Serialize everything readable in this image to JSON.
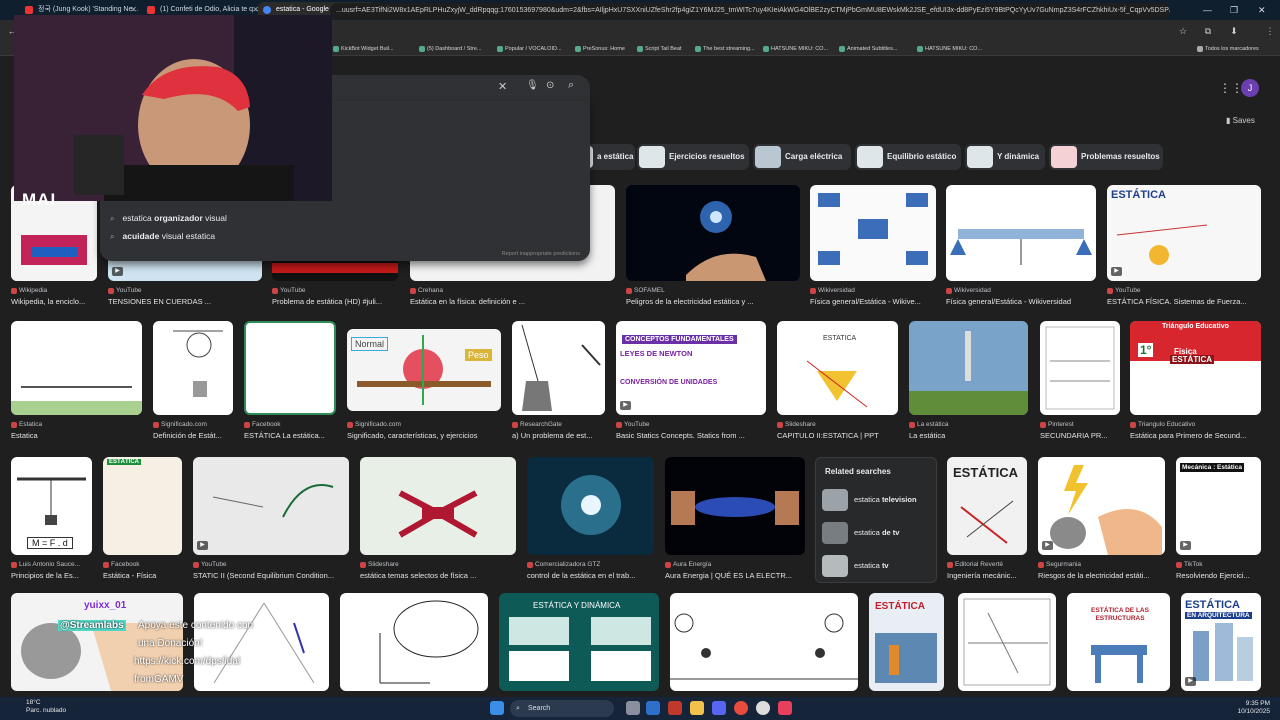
{
  "browser": {
    "tabs": [
      {
        "label": "정국 (Jung Kook) 'Standing Ne..."
      },
      {
        "label": "(1) Confeti de Odio, Alicia te q..."
      },
      {
        "label": "estatica - Google Search"
      }
    ],
    "new_tab": "+",
    "address": "...uusrf=AE3TifNi2W8x1AEpRLPHuZxyjW_ddRpqqg:1760153697980&udm=2&fbs=AIljpHxU7SXXniUZfeShr2fp4giZ1Y6MJ25_tmWITc7uy4KIeiAkWG4OlBE2zyCTMjPbGmMU8EWskMk2JSE_efdUI3x-dd8PyEzi5Y9BtPQcYyUv7GuNmpZ3S4rFCZhkhiUx-5f_CqpVv5DSP3Og5...",
    "bookmarks": [
      "KickBot Widget Buil...",
      "(5) Dashboard / Stre...",
      "Popular / VOCALOID...",
      "PreSonus: Home",
      "Script Tail Beat",
      "The best streaming...",
      "HATSUNE MIKU: CO...",
      "Animated Subtitles...",
      "HATSUNE MIKU: CO..."
    ],
    "all_bookmarks": "Todos los marcadores"
  },
  "header": {
    "account_initial": "J",
    "saves_label": "Saves"
  },
  "suggestions": {
    "items": [
      {
        "prefix": "estatica ",
        "bold": "organizador",
        "suffix": " visual"
      },
      {
        "prefix": "",
        "bold": "acuidade",
        "suffix": " visual estatica"
      }
    ],
    "report": "Report inappropriate predictions"
  },
  "chips": [
    "a estática",
    "Ejercicios resueltos",
    "Carga eléctrica",
    "Equilibrio estático",
    "Y dinámica",
    "Problemas resueltos"
  ],
  "row1": [
    {
      "src": "Wikipedia",
      "title": "Wikipedia, la enciclo..."
    },
    {
      "src": "YouTube",
      "title": "TENSIONES EN CUERDAS ..."
    },
    {
      "src": "YouTube",
      "title": "Problema de estática (HD) #juli..."
    },
    {
      "src": "Crehana",
      "title": "Estática en la física: definición e ..."
    },
    {
      "src": "SOFAMEL",
      "title": "Peligros de la electricidad estática y ..."
    },
    {
      "src": "Wikiversidad",
      "title": "Física general/Estática - Wikive..."
    },
    {
      "src": "Wikiversidad",
      "title": "Física general/Estática - Wikiversidad"
    },
    {
      "src": "YouTube",
      "title": "ESTÁTICA FÍSICA. Sistemas de Fuerza..."
    }
  ],
  "row2": [
    {
      "src": "Estatica",
      "title": "Estatica"
    },
    {
      "src": "Significado.com",
      "title": "Definición de Estát..."
    },
    {
      "src": "Facebook",
      "title": "ESTÁTICA La estática..."
    },
    {
      "src": "Significado.com",
      "title": "Significado, características, y ejercicios"
    },
    {
      "src": "ResearchGate",
      "title": "a) Un problema de est..."
    },
    {
      "src": "YouTube",
      "title": "Basic Statics Concepts. Statics from ..."
    },
    {
      "src": "Slideshare",
      "title": "CAPITULO II:ESTATICA | PPT"
    },
    {
      "src": "La estática",
      "title": "La estática"
    },
    {
      "src": "Pinterest",
      "title": "SECUNDARIA PR..."
    },
    {
      "src": "Triangulo Educativo",
      "title": "Estática para Primero de Secund..."
    }
  ],
  "row3": [
    {
      "src": "Luis Antonio Sauce...",
      "title": "Principios de la Es..."
    },
    {
      "src": "Facebook",
      "title": "Estática - Física"
    },
    {
      "src": "YouTube",
      "title": "STATIC II (Second Equilibrium Condition..."
    },
    {
      "src": "Slideshare",
      "title": "estática temas selectos de física ..."
    },
    {
      "src": "Comercializadora GTZ",
      "title": "control de la estática en el trab..."
    },
    {
      "src": "Aura Energía",
      "title": "Aura Energia | QUÉ ES LA ELECTR..."
    },
    {
      "src": "Editorial Reverté",
      "title": "Ingeniería mecánic..."
    },
    {
      "src": "Segurmania",
      "title": "Riesgos de la electricidad estáti..."
    },
    {
      "src": "TikTok",
      "title": "Resolviendo Ejercici..."
    }
  ],
  "related": {
    "heading": "Related searches",
    "items": [
      {
        "prefix": "estatica ",
        "bold": "television"
      },
      {
        "prefix": "estatica ",
        "bold": "de tv"
      },
      {
        "prefix": "estatica ",
        "bold": "tv"
      }
    ]
  },
  "image_text": {
    "row1_estatica": "ESTÁTICA",
    "row2_normal": "Normal",
    "row2_peso": "Peso",
    "row2_conceptos": "CONCEPTOS FUNDAMENTALES",
    "row2_leyes": "LEYES DE NEWTON",
    "row2_conversion": "CONVERSIÓN DE UNIDADES",
    "row2_estatica_sm": "ESTATICA",
    "row2_triangulo": "Triángulo Educativo",
    "row2_fisica": "Física",
    "row2_estatica_tri": "ESTÁTICA",
    "row2_grade": "1°",
    "row3_md": "M = F . d",
    "row3_estatica_tag": "ESTÁTICA",
    "row3_estatica_book": "ESTÁTICA",
    "row3_mecanica": "Mecánica : Estática",
    "row4_estatica_dinamica": "ESTÁTICA Y DINÁMICA",
    "row4_estatica_book": "ESTÁTICA",
    "row4_estructuras": "ESTÁTICA DE LAS ESTRUCTURAS",
    "row4_arquitectura_1": "ESTÁTICA",
    "row4_arquitectura_2": "EN ARQUITECTURA"
  },
  "stream": {
    "cam_label": "MAI",
    "overlay_user": "yuixx_01",
    "overlay_brand": "@Streamlabs",
    "overlay_line1": "Apoya este contenido con",
    "overlay_line2": "una Donación!",
    "overlay_line3": "https://kick.com/dps/ldal",
    "overlay_line4": "fromGAMV"
  },
  "taskbar": {
    "temp": "18°C",
    "weather": "Parc. nublado",
    "search": "Search",
    "time": "9:35 PM",
    "date": "10/10/2025"
  },
  "colors": {
    "page_bg": "#1f1f1f",
    "surface": "#303134",
    "accent": "#8ab4f8",
    "account": "#6b3fb0"
  }
}
